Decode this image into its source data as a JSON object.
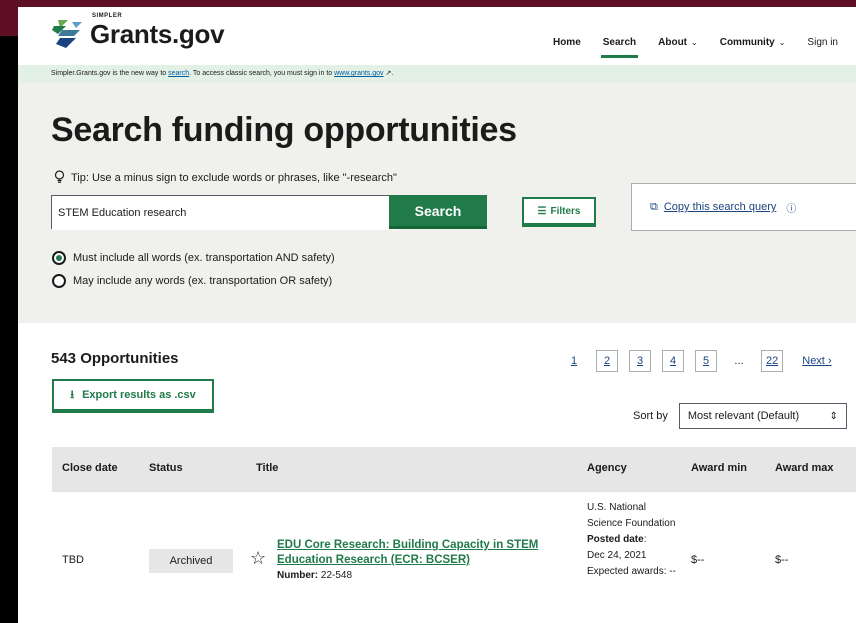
{
  "header": {
    "logo_small": "SIMPLER",
    "logo_name": "Grants.gov",
    "nav": [
      {
        "label": "Home"
      },
      {
        "label": "Search"
      },
      {
        "label": "About"
      },
      {
        "label": "Community"
      },
      {
        "label": "Sign in"
      }
    ]
  },
  "banner": {
    "text_before": "Simpler.Grants.gov is the new way to ",
    "link1": "search",
    "text_middle": ". To access classic search, you must sign in to ",
    "link2": "www.grants.gov",
    "external_glyph": "↗",
    "text_after": "."
  },
  "hero": {
    "title": "Search funding opportunities",
    "tip": "Tip: Use a minus sign to exclude words or phrases, like \"-research\"",
    "search_value": "STEM Education research",
    "search_button": "Search",
    "filters_button": "Filters",
    "copy_query": "Copy this search query",
    "radio_all": "Must include all words (ex. transportation AND safety)",
    "radio_any": "May include any words (ex. transportation OR safety)"
  },
  "results": {
    "count": "543 Opportunities",
    "export_button": "Export results as .csv",
    "pages": [
      "1",
      "2",
      "3",
      "4",
      "5",
      "...",
      "22"
    ],
    "next": "Next",
    "sort_label": "Sort by",
    "sort_value": "Most relevant (Default)"
  },
  "table": {
    "headers": [
      "Close date",
      "Status",
      "Title",
      "Agency",
      "Award min",
      "Award max"
    ],
    "rows": [
      {
        "close_date": "TBD",
        "status": "Archived",
        "title": "EDU Core Research: Building Capacity in STEM Education Research (ECR: BCSER)",
        "number_label": "Number:",
        "number": "22-548",
        "agency": "U.S. National Science Foundation",
        "posted_label": "Posted date",
        "posted_date": "Dec 24, 2021",
        "expected_label": "Expected awards: --",
        "award_min": "$--",
        "award_max": "$--"
      }
    ]
  },
  "colors": {
    "brand_green": "#207a4a",
    "link_blue": "#1a4480",
    "banner_green": "#e3f0e6",
    "hero_gray": "#f0f0ec",
    "frame_maroon": "#5e0f25"
  }
}
